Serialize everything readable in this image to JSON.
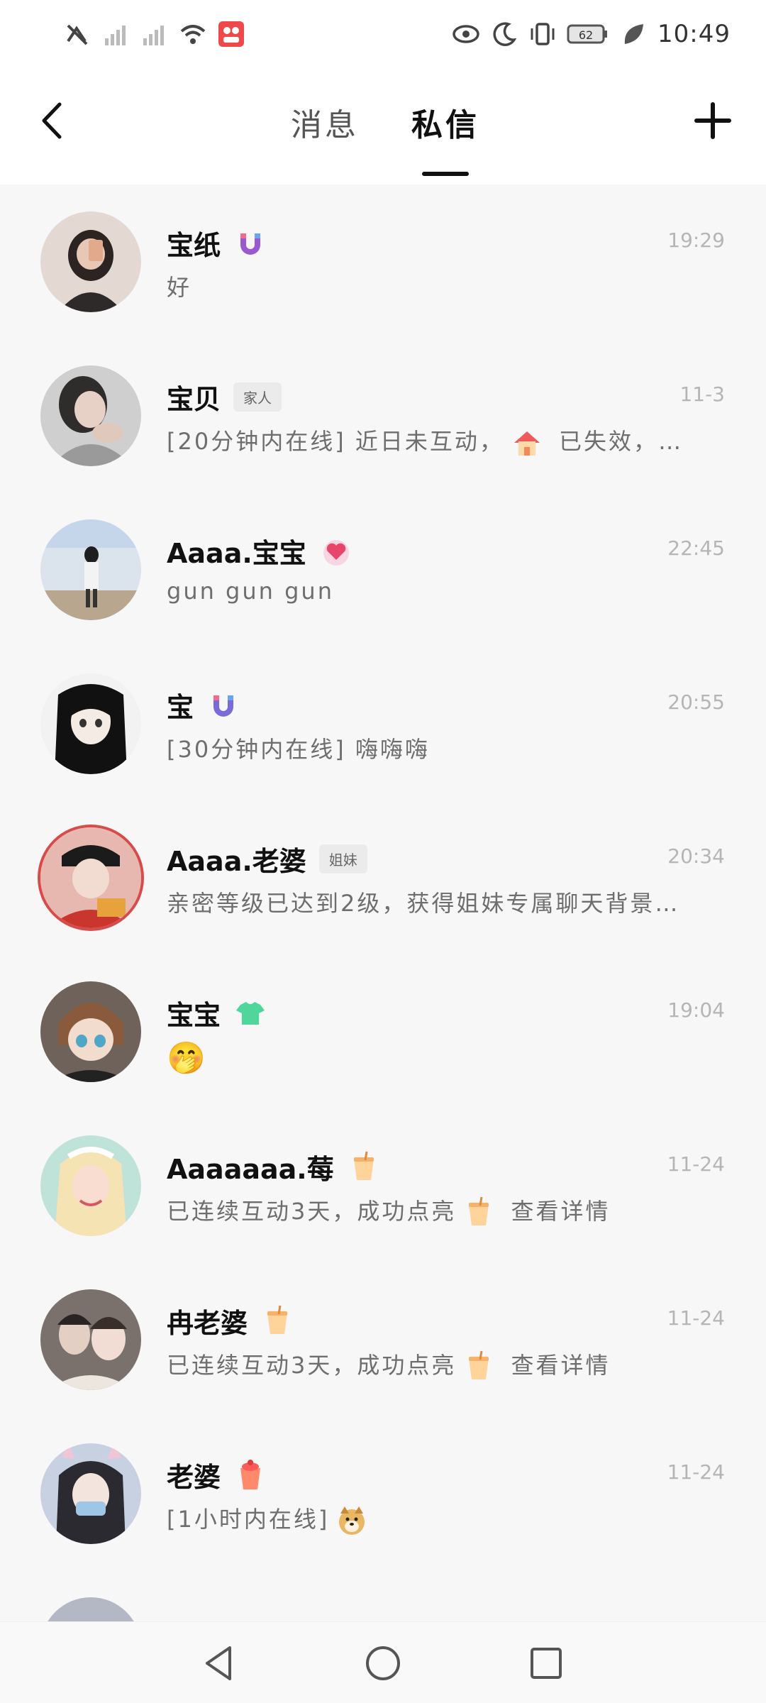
{
  "status_bar": {
    "time": "10:49",
    "battery": "62",
    "icons_left": [
      "no-sim-icon",
      "signal-icon",
      "signal-icon",
      "wifi-icon",
      "app-notification-icon"
    ],
    "icons_right": [
      "eye-icon",
      "moon-icon",
      "vibrate-icon",
      "battery-icon",
      "leaf-icon"
    ]
  },
  "header": {
    "tabs": [
      {
        "label": "消息",
        "active": false
      },
      {
        "label": "私信",
        "active": true
      }
    ]
  },
  "conversations": [
    {
      "name": "宝纸",
      "badge": "magnet-badge-icon",
      "tag": "",
      "time": "19:29",
      "preview": "好",
      "avatar_color": "#d9cfc8"
    },
    {
      "name": "宝贝",
      "badge": "",
      "tag": "家人",
      "time": "11-3",
      "preview_before": "[20分钟内在线] 近日未互动，",
      "preview_icon": "house-icon",
      "preview_after": " 已失效，继…",
      "avatar_color": "#bdbdbd"
    },
    {
      "name": "Aaaa.宝宝",
      "badge": "heart-ring-badge-icon",
      "tag": "",
      "time": "22:45",
      "preview": "gun gun gun",
      "avatar_color": "#c7d7e6"
    },
    {
      "name": "宝",
      "badge": "magnet-badge-icon",
      "tag": "",
      "time": "20:55",
      "preview": "[30分钟内在线] 嗨嗨嗨",
      "avatar_color": "#e9e9e9"
    },
    {
      "name": "Aaaa.老婆",
      "badge": "",
      "tag": "姐妹",
      "time": "20:34",
      "preview": "亲密等级已达到2级，获得姐妹专属聊天背景…",
      "avatar_color": "#d96a5f"
    },
    {
      "name": "宝宝",
      "badge": "shirt-badge-icon",
      "tag": "",
      "time": "19:04",
      "preview_emoji": "🤭",
      "preview": "",
      "avatar_color": "#8a7c72"
    },
    {
      "name": "Aaaaaaa.莓",
      "badge": "drink-badge-icon",
      "tag": "",
      "time": "11-24",
      "preview_before": "已连续互动3天，成功点亮",
      "preview_icon": "drink-icon",
      "preview_after": " 查看详情",
      "avatar_color": "#f0d6c8"
    },
    {
      "name": "冉老婆",
      "badge": "drink-badge-icon",
      "tag": "",
      "time": "11-24",
      "preview_before": "已连续互动3天，成功点亮",
      "preview_icon": "drink-icon",
      "preview_after": " 查看详情",
      "avatar_color": "#8d8580"
    },
    {
      "name": "老婆",
      "badge": "red-drink-badge-icon",
      "tag": "",
      "time": "11-24",
      "preview_before": "[1小时内在线]",
      "preview_icon": "doge-icon",
      "preview_after": "",
      "avatar_color": "#b8c4d8"
    }
  ],
  "colors": {
    "accent": "#111111",
    "background": "#f7f7f8",
    "muted_text": "#6e6e6e",
    "time_text": "#b5b5b5"
  }
}
